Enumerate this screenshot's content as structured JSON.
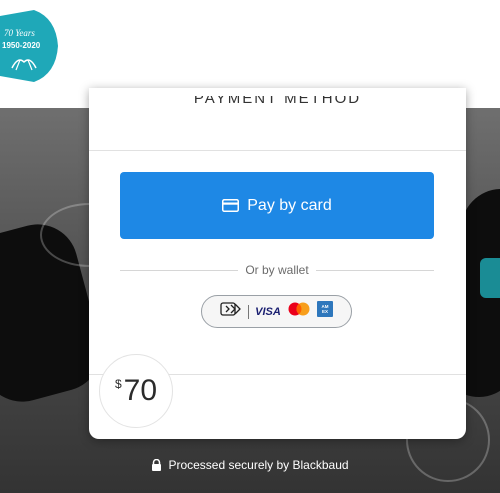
{
  "header": {
    "logo_text_line1": "70 Years",
    "logo_text_line2": "1950-2020",
    "logo_color": "#1fa8b8"
  },
  "modal": {
    "title": "PAYMENT METHOD"
  },
  "pay_card": {
    "label": "Pay by card",
    "icon": "credit-card-icon",
    "color": "#1e88e5"
  },
  "wallet": {
    "divider_label": "Or by wallet",
    "brands": [
      "contactless",
      "VISA",
      "mastercard",
      "amex"
    ]
  },
  "amount": {
    "currency": "$",
    "value": "70"
  },
  "footer": {
    "secure_text": "Processed securely by Blackbaud",
    "icon": "lock-icon"
  }
}
